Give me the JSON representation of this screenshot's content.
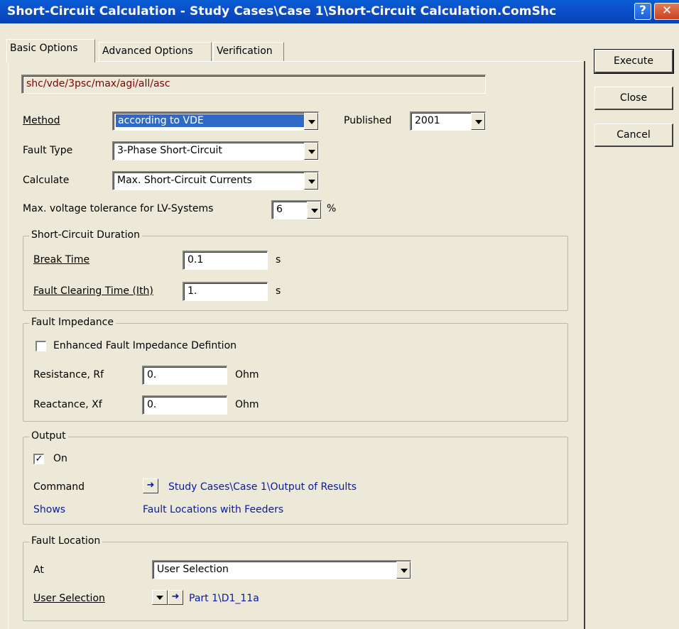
{
  "window": {
    "title": "Short-Circuit Calculation - Study Cases\\Case 1\\Short-Circuit Calculation.ComShc",
    "help_glyph": "?",
    "close_glyph": "✕"
  },
  "tabs": [
    {
      "label": "Basic Options",
      "active": true
    },
    {
      "label": "Advanced Options",
      "active": false
    },
    {
      "label": "Verification",
      "active": false
    }
  ],
  "side_buttons": {
    "execute": "Execute",
    "close": "Close",
    "cancel": "Cancel"
  },
  "command_string": "shc/vde/3psc/max/agi/all/asc",
  "method": {
    "label": "Method",
    "value": "according to VDE"
  },
  "published": {
    "label": "Published",
    "value": "2001"
  },
  "fault_type": {
    "label": "Fault Type",
    "value": "3-Phase Short-Circuit"
  },
  "calculate": {
    "label": "Calculate",
    "value": "Max. Short-Circuit Currents"
  },
  "voltage_tolerance": {
    "label": "Max. voltage tolerance for LV-Systems",
    "value": "6",
    "unit": "%"
  },
  "duration": {
    "title": "Short-Circuit Duration",
    "break_time": {
      "label": "Break Time",
      "value": "0.1",
      "unit": "s"
    },
    "clearing_time": {
      "label": "Fault Clearing Time (Ith)",
      "value": "1.",
      "unit": "s"
    }
  },
  "impedance": {
    "title": "Fault Impedance",
    "enhanced_label": "Enhanced Fault Impedance Defintion",
    "resistance": {
      "label": "Resistance, Rf",
      "value": "0.",
      "unit": "Ohm"
    },
    "reactance": {
      "label": "Reactance, Xf",
      "value": "0.",
      "unit": "Ohm"
    }
  },
  "output": {
    "title": "Output",
    "on_label": "On",
    "on_checked": true,
    "check_glyph": "✓",
    "command_label": "Command",
    "command_value": "Study Cases\\Case 1\\Output of Results",
    "shows_label": "Shows",
    "shows_value": "Fault Locations with Feeders",
    "arrow_glyph": "➜"
  },
  "location": {
    "title": "Fault Location",
    "at_label": "At",
    "at_value": "User Selection",
    "user_selection_label": "User Selection",
    "user_selection_value": "Part 1\\D1_11a"
  }
}
